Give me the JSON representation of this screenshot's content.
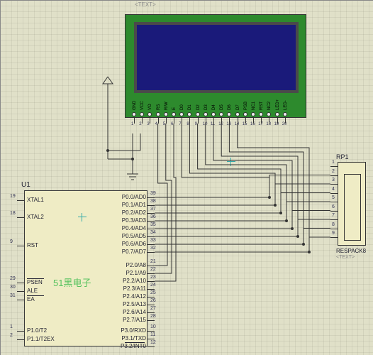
{
  "text_top": "<TEXT>",
  "lcd": {
    "pins": [
      "GND",
      "VCC",
      "VO",
      "RS",
      "R/W",
      "E",
      "D0",
      "D1",
      "D2",
      "D3",
      "D4",
      "D5",
      "D6",
      "D7",
      "PSB",
      "NC1",
      "RST",
      "NC2",
      "LED+",
      "LED-"
    ],
    "pin_numbers": [
      "1",
      "2",
      "3",
      "4",
      "5",
      "6",
      "7",
      "8",
      "9",
      "10",
      "11",
      "12",
      "13",
      "14",
      "15",
      "16",
      "17",
      "18",
      "19",
      "20"
    ]
  },
  "mcu": {
    "ref": "U1",
    "watermark": "51黑电子",
    "left_pins": [
      {
        "num": "19",
        "name": "XTAL1"
      },
      {
        "num": "18",
        "name": "XTAL2"
      },
      {
        "num": "9",
        "name": "RST"
      },
      {
        "num": "29",
        "name": "PSEN",
        "over": true
      },
      {
        "num": "30",
        "name": "ALE"
      },
      {
        "num": "31",
        "name": "EA",
        "over": true
      },
      {
        "num": "1",
        "name": "P1.0/T2"
      },
      {
        "num": "2",
        "name": "P1.1/T2EX"
      }
    ],
    "right_top": [
      {
        "num": "39",
        "name": "P0.0/AD0"
      },
      {
        "num": "38",
        "name": "P0.1/AD1"
      },
      {
        "num": "37",
        "name": "P0.2/AD2"
      },
      {
        "num": "36",
        "name": "P0.3/AD3"
      },
      {
        "num": "35",
        "name": "P0.4/AD4"
      },
      {
        "num": "34",
        "name": "P0.5/AD5"
      },
      {
        "num": "33",
        "name": "P0.6/AD6"
      },
      {
        "num": "32",
        "name": "P0.7/AD7"
      }
    ],
    "right_mid": [
      {
        "num": "21",
        "name": "P2.0/A8"
      },
      {
        "num": "22",
        "name": "P2.1/A9"
      },
      {
        "num": "23",
        "name": "P2.2/A10"
      },
      {
        "num": "24",
        "name": "P2.3/A11"
      },
      {
        "num": "25",
        "name": "P2.4/A12"
      },
      {
        "num": "26",
        "name": "P2.5/A13"
      },
      {
        "num": "27",
        "name": "P2.6/A14"
      },
      {
        "num": "28",
        "name": "P2.7/A15"
      }
    ],
    "right_bot": [
      {
        "num": "10",
        "name": "P3.0/RXD"
      },
      {
        "num": "11",
        "name": "P3.1/TXD"
      },
      {
        "num": "12",
        "name": "P3.2/INT0",
        "over": true
      }
    ]
  },
  "rp": {
    "ref": "RP1",
    "name": "RESPACK8",
    "text": "<TEXT>",
    "pins": [
      "1",
      "2",
      "3",
      "4",
      "5",
      "6",
      "7",
      "8",
      "9"
    ]
  }
}
